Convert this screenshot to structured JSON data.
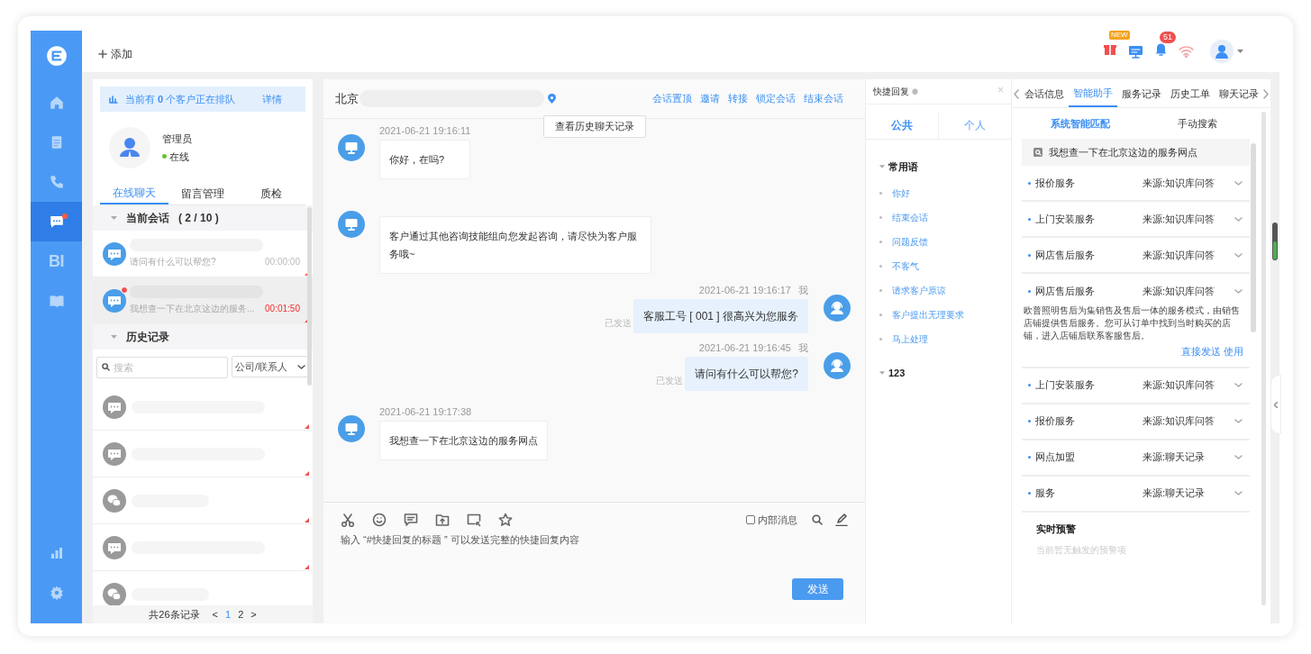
{
  "sidebar": {
    "items": [
      {
        "kind": "home",
        "selected": false,
        "badge": false
      },
      {
        "kind": "document",
        "selected": false,
        "badge": false
      },
      {
        "kind": "phone",
        "selected": false,
        "badge": false
      },
      {
        "kind": "chat",
        "selected": true,
        "badge": true
      },
      {
        "kind": "bi",
        "label": "BI",
        "selected": false,
        "badge": false
      },
      {
        "kind": "book",
        "selected": false,
        "badge": false
      }
    ],
    "bottom_items": [
      {
        "kind": "chart",
        "selected": false,
        "badge": false
      },
      {
        "kind": "settings",
        "selected": false,
        "badge": false
      }
    ]
  },
  "topbar": {
    "add_label": "添加",
    "gift_badge": "NEW",
    "notification_count": "51"
  },
  "queue": {
    "text": "当前有 **0** 个客户正在排队",
    "link": "详情"
  },
  "agent": {
    "name": "管理员",
    "status": "在线",
    "online": true
  },
  "left_tabs": [
    {
      "label": "在线聊天",
      "selected": true
    },
    {
      "label": "留言管理",
      "selected": false
    },
    {
      "label": "质检",
      "selected": false
    }
  ],
  "current_sessions": {
    "title": "当前会话",
    "count": "( 2 / 10 )",
    "items": [
      {
        "preview": "请问有什么可以帮您?",
        "time": "00:00:00",
        "unread": false,
        "selected": false,
        "overdue": false
      },
      {
        "preview": "我想查一下在北京这边的服务...",
        "time": "00:01:50",
        "unread": true,
        "selected": true,
        "overdue": true
      }
    ]
  },
  "history": {
    "title": "历史记录",
    "search_placeholder": "搜索",
    "filter": "公司/联系人",
    "items": [
      {
        "kind": "chat"
      },
      {
        "kind": "chat"
      },
      {
        "kind": "wechat"
      },
      {
        "kind": "chat"
      },
      {
        "kind": "wechat"
      }
    ],
    "total": "共26条记录",
    "pages": [
      {
        "label": "1",
        "selected": true
      },
      {
        "label": "2",
        "selected": false
      }
    ],
    "prev": "<",
    "next": ">"
  },
  "chat": {
    "location": "北京",
    "actions": [
      "会话置顶",
      "邀请",
      "转接",
      "锁定会话",
      "结束会话"
    ],
    "history_button": "查看历史聊天记录",
    "messages": [
      {
        "kind": "customer",
        "time": "2021-06-21 19:16:11",
        "text": "你好，在吗?"
      },
      {
        "kind": "customer",
        "text": "客户通过其他咨询技能组向您发起咨询，请尽快为客户服务哦~"
      },
      {
        "kind": "agent",
        "time": "2021-06-21 19:16:17",
        "sender": "我",
        "status": "已发送",
        "text": "客服工号 [ 001 ] 很高兴为您服务"
      },
      {
        "kind": "agent",
        "time": "2021-06-21 19:16:45",
        "sender": "我",
        "status": "已发送",
        "text": "请问有什么可以帮您?"
      },
      {
        "kind": "customer",
        "time": "2021-06-21 19:17:38",
        "text": "我想查一下在北京这边的服务网点"
      }
    ],
    "internal_label": "内部消息",
    "internal_checked": false,
    "input_placeholder": "输入 “#快捷回复的标题 ” 可以发送完整的快捷回复内容",
    "send": "发送"
  },
  "quick_reply": {
    "title": "快捷回复",
    "close": "×",
    "tabs": [
      {
        "label": "公共",
        "selected": true
      },
      {
        "label": "个人",
        "selected": false
      }
    ],
    "groups": [
      {
        "title": "常用语",
        "items": [
          "你好",
          "结束会话",
          "问题反馈",
          "不客气",
          "请求客户原谅",
          "客户提出无理要求",
          "马上处理"
        ]
      },
      {
        "title": "123"
      }
    ]
  },
  "assistant": {
    "tabs": [
      {
        "label": "会话信息",
        "selected": false
      },
      {
        "label": "智能助手",
        "selected": true
      },
      {
        "label": "服务记录",
        "selected": false
      },
      {
        "label": "历史工单",
        "selected": false
      },
      {
        "label": "聊天记录",
        "selected": false
      }
    ],
    "modes": [
      {
        "label": "系统智能匹配",
        "selected": true
      },
      {
        "label": "手动搜索",
        "selected": false
      }
    ],
    "query": "我想查一下在北京这边的服务网点",
    "results": [
      {
        "title": "报价服务",
        "source": "来源:知识库问答",
        "expanded": false
      },
      {
        "title": "上门安装服务",
        "source": "来源:知识库问答",
        "expanded": false
      },
      {
        "title": "网店售后服务",
        "source": "来源:知识库问答",
        "expanded": false
      },
      {
        "title": "网店售后服务",
        "source": "来源:知识库问答",
        "expanded": true,
        "answer": "欧普照明售后为集销售及售后一体的服务模式，由销售店铺提供售后服务。您可从订单中找到当时购买的店铺，进入店铺后联系客服售后。",
        "actions": [
          "直接发送",
          "使用"
        ]
      },
      {
        "title": "上门安装服务",
        "source": "来源:知识库问答",
        "expanded": false
      },
      {
        "title": "报价服务",
        "source": "来源:知识库问答",
        "expanded": false
      },
      {
        "title": "网点加盟",
        "source": "来源:聊天记录",
        "expanded": false
      },
      {
        "title": "服务",
        "source": "来源:聊天记录",
        "expanded": false
      }
    ],
    "alert_title": "实时预警",
    "alert_empty": "当前暂无触发的预警项"
  }
}
